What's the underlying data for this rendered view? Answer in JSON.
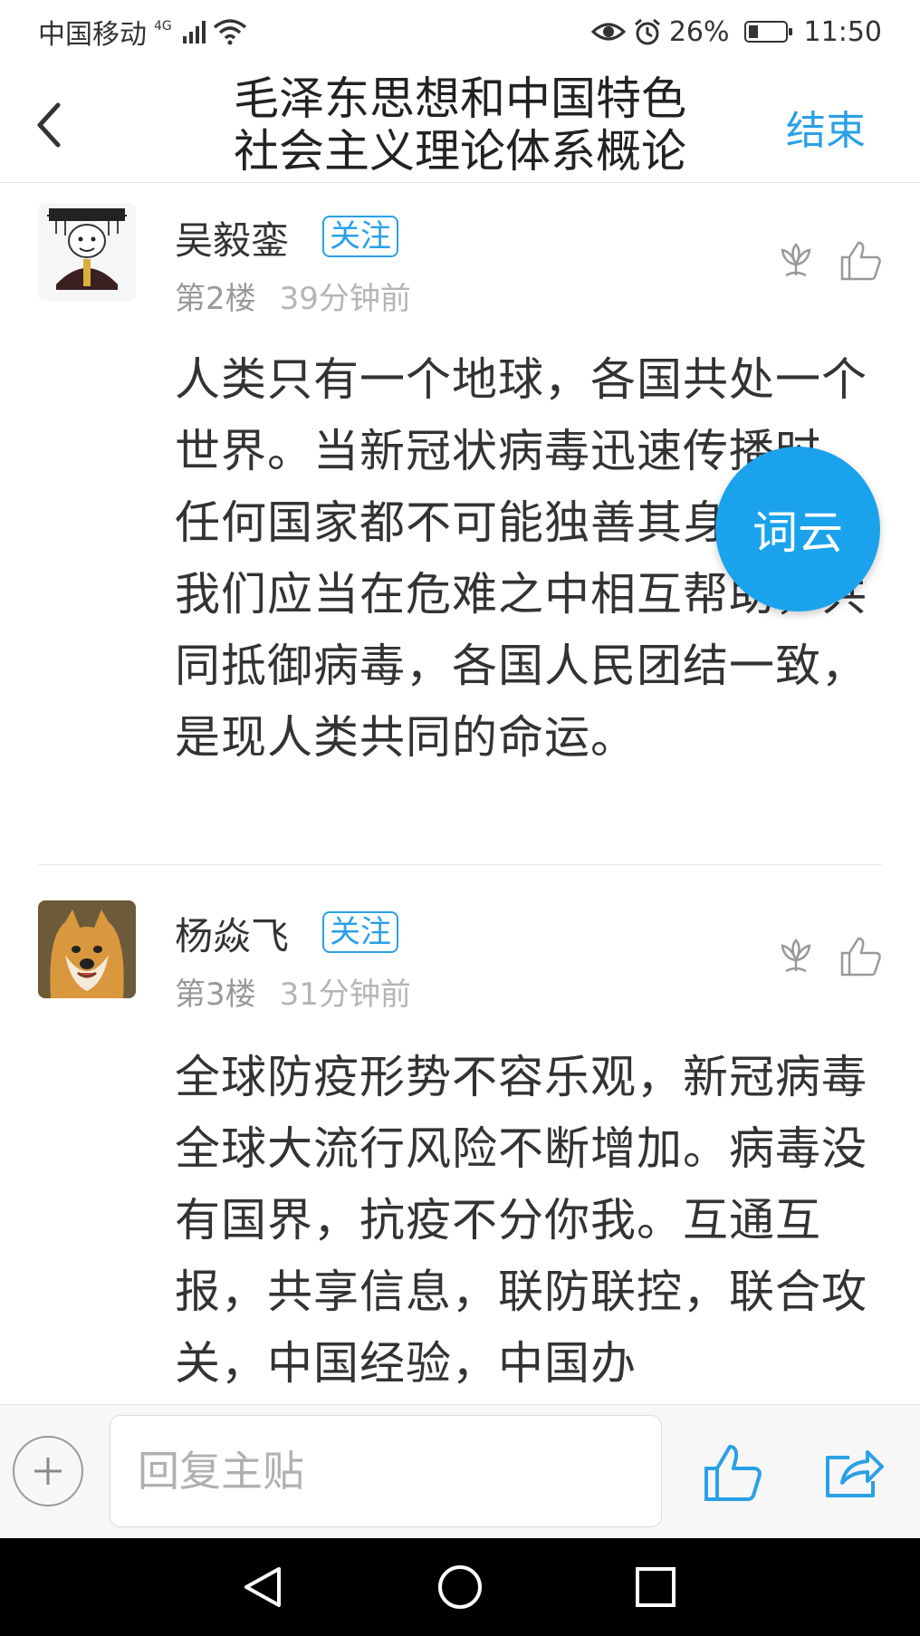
{
  "status_bar": {
    "carrier": "中国移动",
    "network": "4G",
    "battery": "26%",
    "battery_level": 0.26,
    "time": "11:50"
  },
  "nav": {
    "title_line1": "毛泽东思想和中国特色",
    "title_line2": "社会主义理论体系概论",
    "end_label": "结束"
  },
  "posts": [
    {
      "username": "吴毅銮",
      "follow_label": "关注",
      "floor": "第2楼",
      "time": "39分钟前",
      "content": "人类只有一个地球，各国共处一个世界。当新冠状病毒迅速传播时，任何国家都不可能独善其身。所以我们应当在危难之中相互帮助，共同抵御病毒，各国人民团结一致，是现人类共同的命运。"
    },
    {
      "username": "杨焱飞",
      "follow_label": "关注",
      "floor": "第3楼",
      "time": "31分钟前",
      "content": "全球防疫形势不容乐观，新冠病毒全球大流行风险不断增加。病毒没有国界，抗疫不分你我。互通互报，共享信息，联防联控，联合攻关，中国经验，中国办"
    }
  ],
  "fab_label": "词云",
  "reply": {
    "placeholder": "回复主贴"
  },
  "colors": {
    "accent": "#2aa0e6",
    "fab": "#1aa3ec"
  }
}
